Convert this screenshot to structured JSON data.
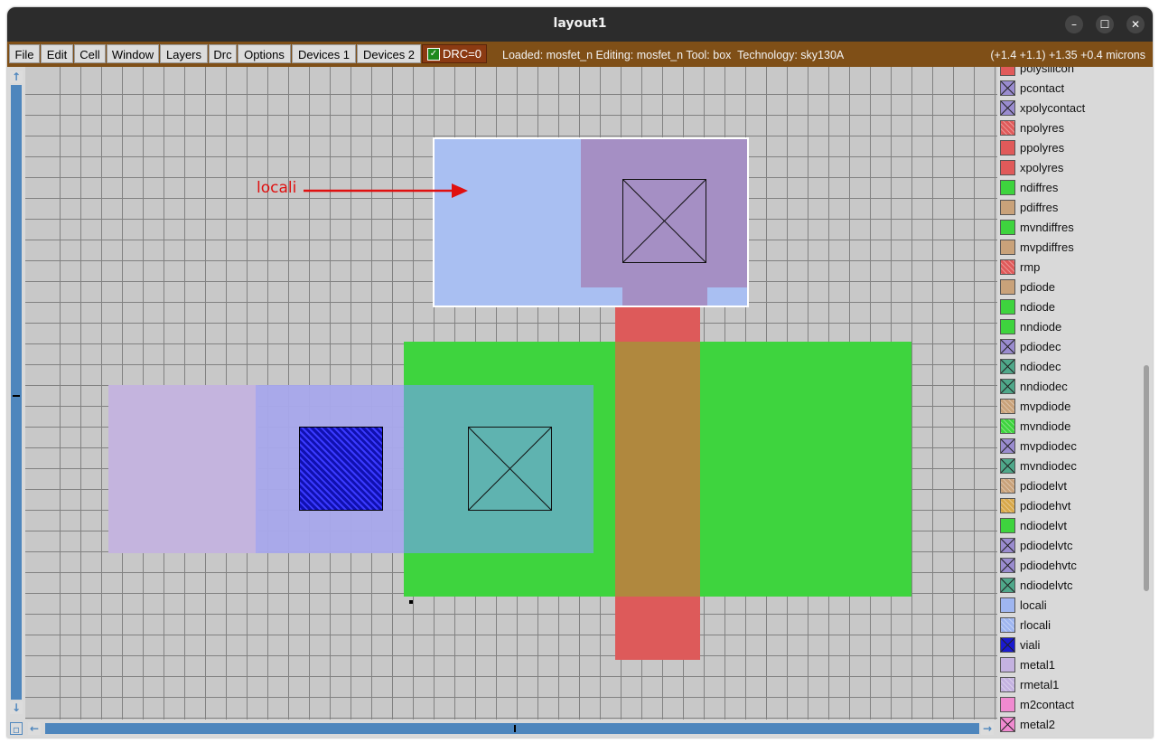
{
  "window": {
    "title": "layout1",
    "controls": [
      "–",
      "☐",
      "✕"
    ]
  },
  "menu": [
    "File",
    "Edit",
    "Cell",
    "Window",
    "Layers",
    "Drc",
    "Options",
    "Devices 1",
    "Devices 2"
  ],
  "drc": {
    "label": "DRC=0",
    "checked": true
  },
  "status": "Loaded: mosfet_n Editing: mosfet_n Tool: box  Technology: sky130A",
  "coords": "(+1.4 +1.1) +1.35 +0.4 microns",
  "annotation": {
    "text": "locali",
    "color": "#e01010"
  },
  "layers": [
    {
      "name": "polysilicon",
      "color": "#e05a5a",
      "pattern": "solid"
    },
    {
      "name": "pcontact",
      "color": "#9a8ccf",
      "pattern": "cross"
    },
    {
      "name": "xpolycontact",
      "color": "#9a8ccf",
      "pattern": "cross"
    },
    {
      "name": "npolyres",
      "color": "#e05a5a",
      "pattern": "hatch"
    },
    {
      "name": "ppolyres",
      "color": "#e05a5a",
      "pattern": "solid"
    },
    {
      "name": "xpolyres",
      "color": "#e05a5a",
      "pattern": "solid"
    },
    {
      "name": "ndiffres",
      "color": "#3ed43e",
      "pattern": "solid"
    },
    {
      "name": "pdiffres",
      "color": "#c9a27a",
      "pattern": "solid"
    },
    {
      "name": "mvndiffres",
      "color": "#3ed43e",
      "pattern": "solid"
    },
    {
      "name": "mvpdiffres",
      "color": "#c9a27a",
      "pattern": "solid"
    },
    {
      "name": "rmp",
      "color": "#e05a5a",
      "pattern": "hatch"
    },
    {
      "name": "pdiode",
      "color": "#c9a27a",
      "pattern": "solid"
    },
    {
      "name": "ndiode",
      "color": "#3ed43e",
      "pattern": "solid"
    },
    {
      "name": "nndiode",
      "color": "#3ed43e",
      "pattern": "solid"
    },
    {
      "name": "pdiodec",
      "color": "#9a8ccf",
      "pattern": "cross"
    },
    {
      "name": "ndiodec",
      "color": "#4fa88a",
      "pattern": "cross"
    },
    {
      "name": "nndiodec",
      "color": "#4fa88a",
      "pattern": "cross"
    },
    {
      "name": "mvpdiode",
      "color": "#c9a27a",
      "pattern": "hatch"
    },
    {
      "name": "mvndiode",
      "color": "#3ed43e",
      "pattern": "hatch"
    },
    {
      "name": "mvpdiodec",
      "color": "#9a8ccf",
      "pattern": "cross"
    },
    {
      "name": "mvndiodec",
      "color": "#4fa88a",
      "pattern": "cross"
    },
    {
      "name": "pdiodelvt",
      "color": "#c9a27a",
      "pattern": "hatch"
    },
    {
      "name": "pdiodehvt",
      "color": "#d8a84a",
      "pattern": "hatch"
    },
    {
      "name": "ndiodelvt",
      "color": "#3ed43e",
      "pattern": "solid"
    },
    {
      "name": "pdiodelvtc",
      "color": "#9a8ccf",
      "pattern": "cross"
    },
    {
      "name": "pdiodehvtc",
      "color": "#9a8ccf",
      "pattern": "cross"
    },
    {
      "name": "ndiodelvtc",
      "color": "#4fa88a",
      "pattern": "cross"
    },
    {
      "name": "locali",
      "color": "#9fb6f0",
      "pattern": "solid"
    },
    {
      "name": "rlocali",
      "color": "#9fb6f0",
      "pattern": "hatch"
    },
    {
      "name": "viali",
      "color": "#1a1ad0",
      "pattern": "cross"
    },
    {
      "name": "metal1",
      "color": "#c4b2e0",
      "pattern": "solid"
    },
    {
      "name": "rmetal1",
      "color": "#c4b2e0",
      "pattern": "hatch"
    },
    {
      "name": "m2contact",
      "color": "#f08ad0",
      "pattern": "solid"
    },
    {
      "name": "metal2",
      "color": "#f08ad0",
      "pattern": "cross"
    }
  ]
}
